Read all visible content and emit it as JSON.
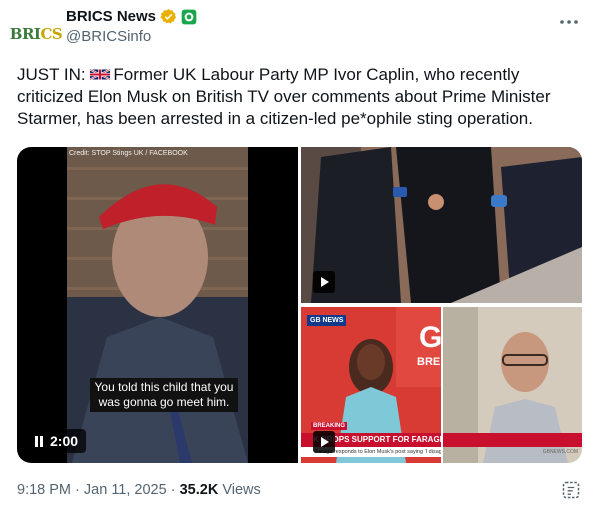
{
  "account": {
    "display_name": "BRICS News",
    "handle": "@BRICSinfo",
    "avatar_text_main": "BRI",
    "avatar_text_accent": "CS"
  },
  "tweet": {
    "text_prefix": "JUST IN:",
    "text_body": "Former UK Labour Party MP Ivor Caplin, who recently criticized Elon Musk on British TV over comments about Prime Minister Starmer, has been arrested in a citizen-led pe*ophile sting operation."
  },
  "media": {
    "main_video": {
      "credit": "Credit: STOP Stings UK / FACEBOOK",
      "caption": "You told this child that you was gonna go meet him.",
      "duration": "2:00"
    },
    "news_tile": {
      "logo": "GB NEWS",
      "breaking": "BREAKING",
      "headline": "UK DROPS SUPPORT FOR FARAGE",
      "headline_left": "K DROPS SUPPORT FOR FARAGE",
      "subline": "Farage responds to Elon Musk's post saying 'I disagree'",
      "source": "GBNEWS.COM"
    }
  },
  "footer": {
    "time": "9:18 PM",
    "separator": "·",
    "date": "Jan 11, 2025",
    "views_count": "35.2K",
    "views_label": "Views"
  },
  "colors": {
    "text": "#0f1419",
    "muted": "#536471",
    "gold_badge": "#e8b100",
    "green_badge": "#1aa64b",
    "news_red": "#c8102e"
  }
}
